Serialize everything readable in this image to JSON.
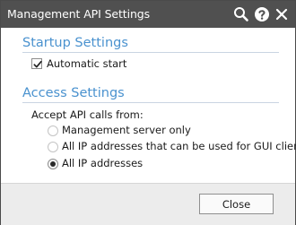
{
  "window": {
    "title": "Management API Settings",
    "icons": [
      "search-icon",
      "help-icon",
      "close-icon"
    ]
  },
  "startup": {
    "title": "Startup Settings",
    "automatic_start": {
      "label": "Automatic start",
      "checked": true
    }
  },
  "access": {
    "title": "Access Settings",
    "prompt": "Accept API calls from:",
    "options": [
      {
        "label": "Management server only",
        "selected": false
      },
      {
        "label": "All IP addresses that can be used for GUI clients",
        "selected": false
      },
      {
        "label": "All IP addresses",
        "selected": true
      }
    ]
  },
  "footer": {
    "close_label": "Close"
  },
  "colors": {
    "titlebar": "#505050",
    "section_title": "#4a92cf",
    "footer": "#ececec"
  }
}
